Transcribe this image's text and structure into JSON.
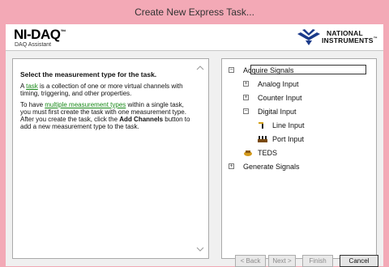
{
  "window": {
    "title": "Create New Express Task..."
  },
  "banner": {
    "product_name": "NI-DAQ",
    "product_tm": "™",
    "product_subtitle": "DAQ Assistant",
    "brand_line1": "NATIONAL",
    "brand_line2": "INSTRUMENTS",
    "brand_tm": "™"
  },
  "help": {
    "heading": "Select the measurement type for the task.",
    "p1_pre": "A ",
    "p1_link": "task",
    "p1_post": " is a collection of one or more virtual channels with timing, triggering, and other properties.",
    "p2_pre": "To have ",
    "p2_link": "multiple measurement types",
    "p2_mid": " within a single task, you must first create the task with one measurement type. After you create the task, click the ",
    "p2_bold": "Add Channels",
    "p2_post": " button to add a new measurement type to the task."
  },
  "tree": {
    "acquire": "Acquire Signals",
    "analog_input": "Analog Input",
    "counter_input": "Counter Input",
    "digital_input": "Digital Input",
    "line_input": "Line Input",
    "port_input": "Port Input",
    "teds": "TEDS",
    "generate": "Generate Signals"
  },
  "footer": {
    "back": "< Back",
    "next": "Next >",
    "finish": "Finish",
    "cancel": "Cancel"
  },
  "colors": {
    "title_bar": "#f3a9b6",
    "link": "#1a8a1a",
    "panel_bg": "#f0f0f0"
  }
}
